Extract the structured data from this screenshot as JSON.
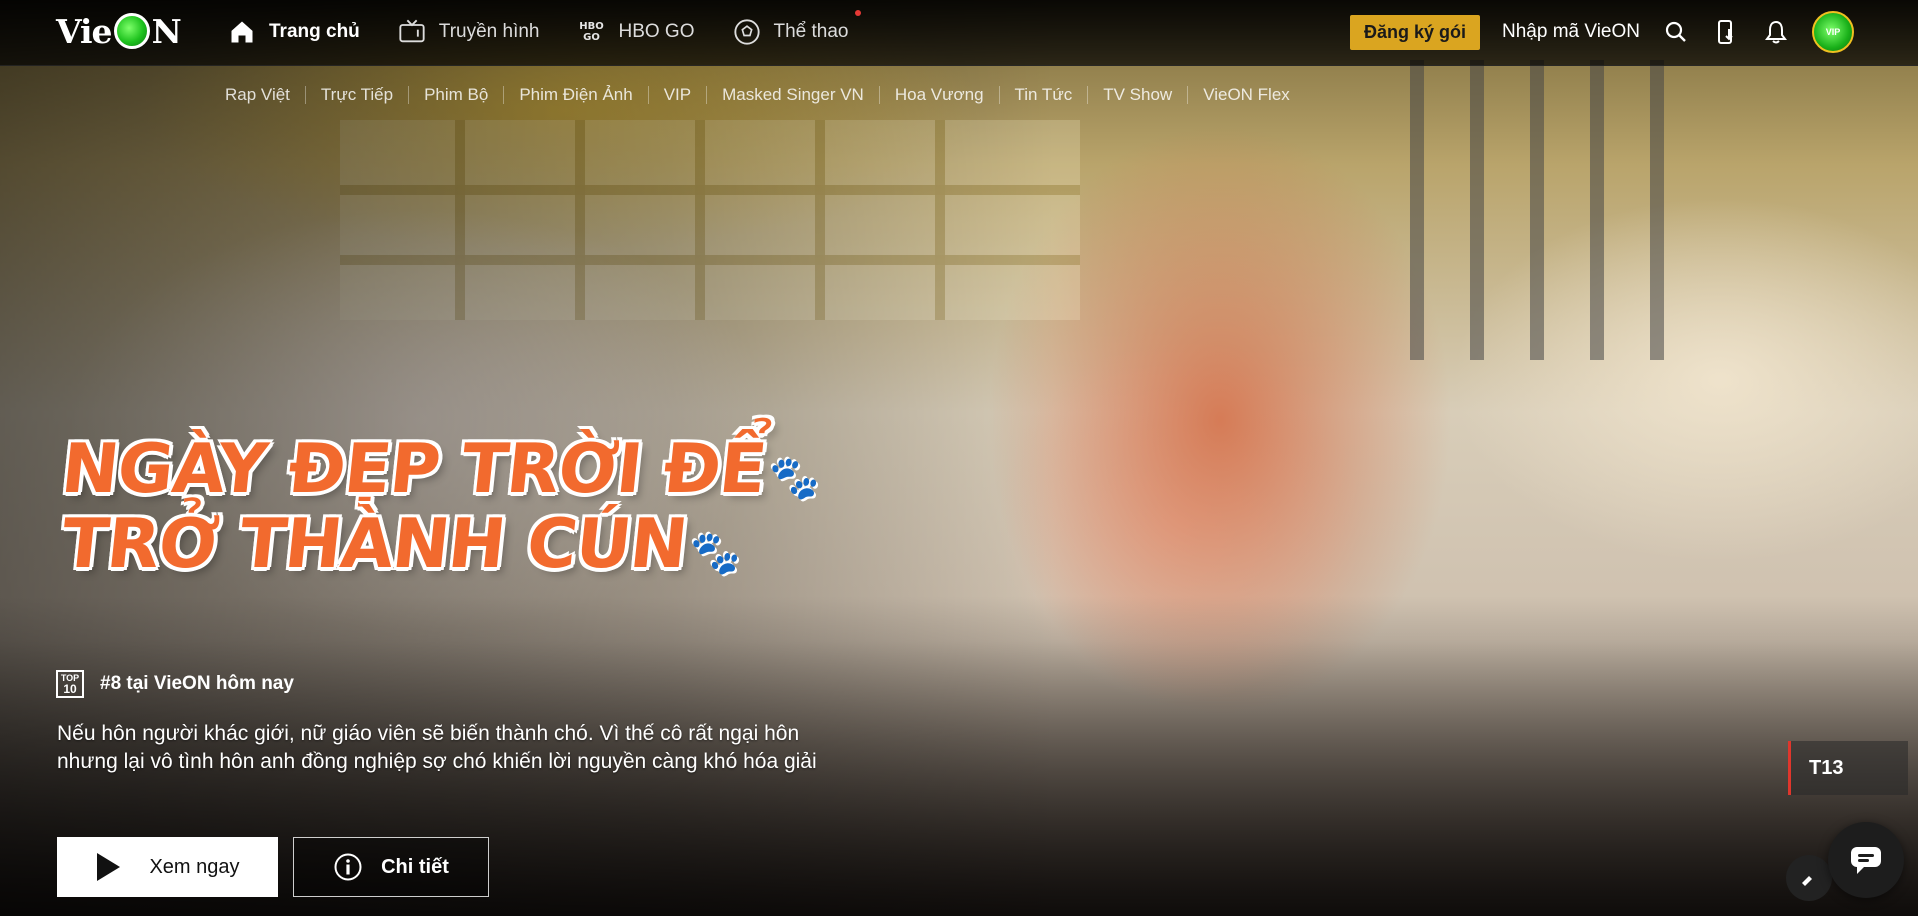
{
  "header": {
    "logo_text": "VieON",
    "nav": [
      {
        "label": "Trang chủ",
        "icon": "home-icon"
      },
      {
        "label": "Truyền hình",
        "icon": "tv-icon"
      },
      {
        "label": "HBO GO",
        "icon": "hbo-icon"
      },
      {
        "label": "Thể thao",
        "icon": "soccer-ball-icon"
      }
    ],
    "hbo_icon_text": "HBO\nGO",
    "subscribe_label": "Đăng ký gói",
    "redeem_label": "Nhập mã VieON",
    "avatar_text": "VIP",
    "icons": [
      "search-icon",
      "download-icon",
      "bell-icon"
    ]
  },
  "subnav": [
    "Rap Việt",
    "Trực Tiếp",
    "Phim Bộ",
    "Phim Điện Ảnh",
    "VIP",
    "Masked Singer VN",
    "Hoa Vương",
    "Tin Tức",
    "TV Show",
    "VieON Flex"
  ],
  "hero": {
    "title_line1": "NGÀY ĐẸP TRỜI ĐỂ",
    "title_line2": "TRỞ THÀNH CÚN",
    "top10_icon_line1": "TOP",
    "top10_icon_line2": "10",
    "rank_text": "#8 tại VieON hôm nay",
    "description": "Nếu hôn người khác giới, nữ giáo viên sẽ biến thành chó. Vì thế cô rất ngại hôn nhưng lại vô tình hôn anh đồng nghiệp sợ chó khiến lời nguyền càng khó hóa giải",
    "play_label": "Xem ngay",
    "detail_label": "Chi tiết",
    "age_rating": "T13"
  },
  "colors": {
    "accent_gold": "#daa520",
    "title_orange": "#f26a2e",
    "rating_red": "#e0362c",
    "notif_dot": "#e53935"
  }
}
